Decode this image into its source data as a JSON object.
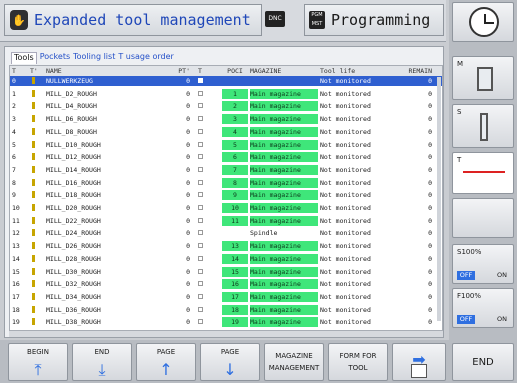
{
  "header": {
    "left_title": "Expanded tool management",
    "dnc_label": "DNC",
    "pgm_label": "PGM MST",
    "right_title": "Programming"
  },
  "tabs": [
    {
      "label": "Tools",
      "active": true
    },
    {
      "label": "Pockets",
      "active": false
    },
    {
      "label": "Tooling list",
      "active": false
    },
    {
      "label": "T usage order",
      "active": false
    }
  ],
  "table": {
    "columns": [
      "T",
      "T'",
      "NAME",
      "PT'",
      "T",
      "POCI",
      "MAGAZINE",
      "Tool life",
      "REMAIN"
    ],
    "rows": [
      {
        "t": "0",
        "name": "NULLWERKZEUG",
        "pt": "0",
        "pocket": "",
        "magazine": "",
        "life": "Not monitored",
        "remain": "0",
        "selected": true
      },
      {
        "t": "1",
        "name": "MILL_D2_ROUGH",
        "pt": "0",
        "pocket": "1",
        "magazine": "Main magazine",
        "life": "Not monitored",
        "remain": "0"
      },
      {
        "t": "2",
        "name": "MILL_D4_ROUGH",
        "pt": "0",
        "pocket": "2",
        "magazine": "Main magazine",
        "life": "Not monitored",
        "remain": "0"
      },
      {
        "t": "3",
        "name": "MILL_D6_ROUGH",
        "pt": "0",
        "pocket": "3",
        "magazine": "Main magazine",
        "life": "Not monitored",
        "remain": "0"
      },
      {
        "t": "4",
        "name": "MILL_D8_ROUGH",
        "pt": "0",
        "pocket": "4",
        "magazine": "Main magazine",
        "life": "Not monitored",
        "remain": "0"
      },
      {
        "t": "5",
        "name": "MILL_D10_ROUGH",
        "pt": "0",
        "pocket": "5",
        "magazine": "Main magazine",
        "life": "Not monitored",
        "remain": "0"
      },
      {
        "t": "6",
        "name": "MILL_D12_ROUGH",
        "pt": "0",
        "pocket": "6",
        "magazine": "Main magazine",
        "life": "Not monitored",
        "remain": "0"
      },
      {
        "t": "7",
        "name": "MILL_D14_ROUGH",
        "pt": "0",
        "pocket": "7",
        "magazine": "Main magazine",
        "life": "Not monitored",
        "remain": "0"
      },
      {
        "t": "8",
        "name": "MILL_D16_ROUGH",
        "pt": "0",
        "pocket": "8",
        "magazine": "Main magazine",
        "life": "Not monitored",
        "remain": "0"
      },
      {
        "t": "9",
        "name": "MILL_D18_ROUGH",
        "pt": "0",
        "pocket": "9",
        "magazine": "Main magazine",
        "life": "Not monitored",
        "remain": "0"
      },
      {
        "t": "10",
        "name": "MILL_D20_ROUGH",
        "pt": "0",
        "pocket": "10",
        "magazine": "Main magazine",
        "life": "Not monitored",
        "remain": "0"
      },
      {
        "t": "11",
        "name": "MILL_D22_ROUGH",
        "pt": "0",
        "pocket": "11",
        "magazine": "Main magazine",
        "life": "Not monitored",
        "remain": "0"
      },
      {
        "t": "12",
        "name": "MILL_D24_ROUGH",
        "pt": "0",
        "pocket": "",
        "magazine": "Spindle",
        "life": "Not monitored",
        "remain": "0"
      },
      {
        "t": "13",
        "name": "MILL_D26_ROUGH",
        "pt": "0",
        "pocket": "13",
        "magazine": "Main magazine",
        "life": "Not monitored",
        "remain": "0"
      },
      {
        "t": "14",
        "name": "MILL_D28_ROUGH",
        "pt": "0",
        "pocket": "14",
        "magazine": "Main magazine",
        "life": "Not monitored",
        "remain": "0"
      },
      {
        "t": "15",
        "name": "MILL_D30_ROUGH",
        "pt": "0",
        "pocket": "15",
        "magazine": "Main magazine",
        "life": "Not monitored",
        "remain": "0"
      },
      {
        "t": "16",
        "name": "MILL_D32_ROUGH",
        "pt": "0",
        "pocket": "16",
        "magazine": "Main magazine",
        "life": "Not monitored",
        "remain": "0"
      },
      {
        "t": "17",
        "name": "MILL_D34_ROUGH",
        "pt": "0",
        "pocket": "17",
        "magazine": "Main magazine",
        "life": "Not monitored",
        "remain": "0"
      },
      {
        "t": "18",
        "name": "MILL_D36_ROUGH",
        "pt": "0",
        "pocket": "18",
        "magazine": "Main magazine",
        "life": "Not monitored",
        "remain": "0"
      },
      {
        "t": "19",
        "name": "MILL_D38_ROUGH",
        "pt": "0",
        "pocket": "19",
        "magazine": "Main magazine",
        "life": "Not monitored",
        "remain": "0"
      }
    ]
  },
  "right_softkeys": {
    "m_label": "M",
    "s_label": "S",
    "t_label": "T",
    "s_override": "S100%",
    "f_override": "F100%",
    "off_label": "OFF",
    "on_label": "ON"
  },
  "bottom_softkeys": {
    "begin": "BEGIN",
    "end": "END",
    "page_up": "PAGE",
    "page_down": "PAGE",
    "magazine_1": "MAGAZINE",
    "magazine_2": "MANAGEMENT",
    "form_1": "FORM FOR",
    "form_2": "TOOL",
    "end_main": "END"
  },
  "colors": {
    "accent": "#2f5fd0",
    "magazine_green": "#3fe67a",
    "title_blue": "#1f47b8"
  }
}
